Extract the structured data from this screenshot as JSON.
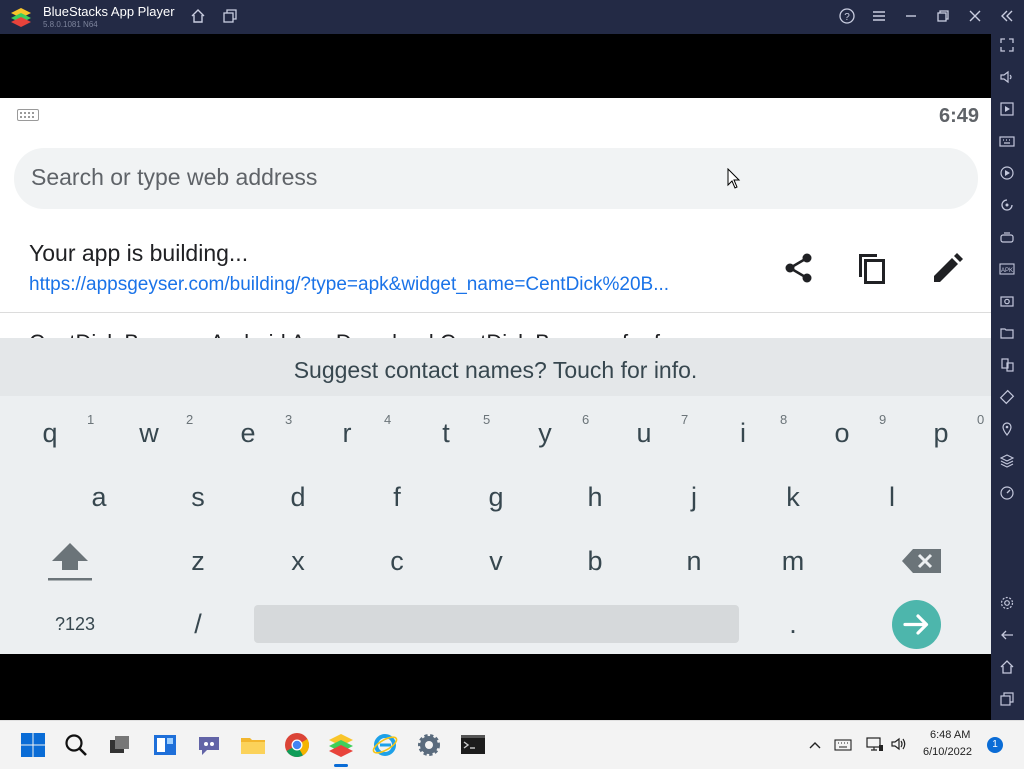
{
  "titlebar": {
    "app_title": "BlueStacks App Player",
    "version": "5.8.0.1081 N64"
  },
  "android": {
    "status_time": "6:49",
    "search": {
      "placeholder": "Search or type web address"
    },
    "building": {
      "title": "Your app is building...",
      "url": "https://appsgeyser.com/building/?type=apk&widget_name=CentDick%20B...",
      "partial_line": "CentDick Browser Android App Download CentDick Browser for free"
    }
  },
  "keyboard": {
    "suggestion": "Suggest contact names? Touch for info.",
    "row1": [
      {
        "key": "q",
        "hint": "1"
      },
      {
        "key": "w",
        "hint": "2"
      },
      {
        "key": "e",
        "hint": "3"
      },
      {
        "key": "r",
        "hint": "4"
      },
      {
        "key": "t",
        "hint": "5"
      },
      {
        "key": "y",
        "hint": "6"
      },
      {
        "key": "u",
        "hint": "7"
      },
      {
        "key": "i",
        "hint": "8"
      },
      {
        "key": "o",
        "hint": "9"
      },
      {
        "key": "p",
        "hint": "0"
      }
    ],
    "row2": [
      "a",
      "s",
      "d",
      "f",
      "g",
      "h",
      "j",
      "k",
      "l"
    ],
    "row3": [
      "z",
      "x",
      "c",
      "v",
      "b",
      "n",
      "m"
    ],
    "symbols_label": "?123",
    "slash": "/",
    "period": "."
  },
  "taskbar": {
    "time": "6:48 AM",
    "date": "6/10/2022",
    "notification_count": "1"
  },
  "colors": {
    "bluestacks_chrome": "#232a45",
    "keyboard_bg": "#eceff1",
    "enter_key": "#4db6ac",
    "link": "#1a73e8"
  },
  "icons": {
    "titlebar": [
      "home-icon",
      "multi-instance-icon",
      "help-icon",
      "menu-icon",
      "minimize-icon",
      "restore-icon",
      "close-icon",
      "collapse-sidebar-icon"
    ],
    "sidebar": [
      "fullscreen-icon",
      "volume-icon",
      "media-icon",
      "keyboard-controls-icon",
      "macro-icon",
      "rotate-sync-icon",
      "game-controls-icon",
      "install-apk-icon",
      "screenshot-icon",
      "folder-icon",
      "multi-instance-manager-icon",
      "rotate-icon",
      "location-icon",
      "layers-icon",
      "performance-icon",
      "settings-icon",
      "back-icon",
      "android-home-icon",
      "recent-apps-icon"
    ]
  }
}
